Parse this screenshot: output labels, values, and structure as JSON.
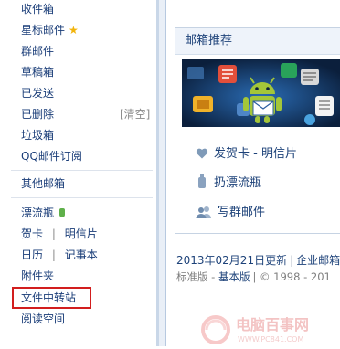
{
  "sidebar": {
    "inbox_label": "收件箱",
    "starred_label": "星标邮件",
    "group_mail_label": "群邮件",
    "drafts_label": "草稿箱",
    "sent_label": "已发送",
    "deleted_label": "已删除",
    "clear_label": "[清空]",
    "spam_label": "垃圾箱",
    "qq_subscription_label": "QQ邮件订阅",
    "other_mailbox_label": "其他邮箱",
    "drift_bottle_label": "漂流瓶",
    "greeting_card_label": "贺卡",
    "postcard_label": "明信片",
    "calendar_label": "日历",
    "notes_label": "记事本",
    "attachments_label": "附件夹",
    "file_transfer_label": "文件中转站",
    "reading_space_label": "阅读空间",
    "pipe": "|"
  },
  "recommend": {
    "title": "邮箱推荐",
    "items": [
      {
        "label": "发贺卡 - 明信片",
        "icon": "heart-icon"
      },
      {
        "label": "扔漂流瓶",
        "icon": "bottle-icon"
      },
      {
        "label": "写群邮件",
        "icon": "group-icon"
      }
    ]
  },
  "footer": {
    "update_date": "2013年02月21日更新",
    "pipe": "|",
    "enterprise_link": "企业邮箱",
    "edition_label": "标准版",
    "edition_sep": " - ",
    "basic_link": "基本版",
    "copyright": "| © 1998 - 201"
  },
  "watermark": {
    "brand": "电脑百事网",
    "url": "WWW.PC841.COM"
  },
  "colors": {
    "link": "#1a3d78",
    "highlight_border": "#d21e1e",
    "panel_header_bg": "#eef3fa",
    "star": "#f2b40c"
  }
}
